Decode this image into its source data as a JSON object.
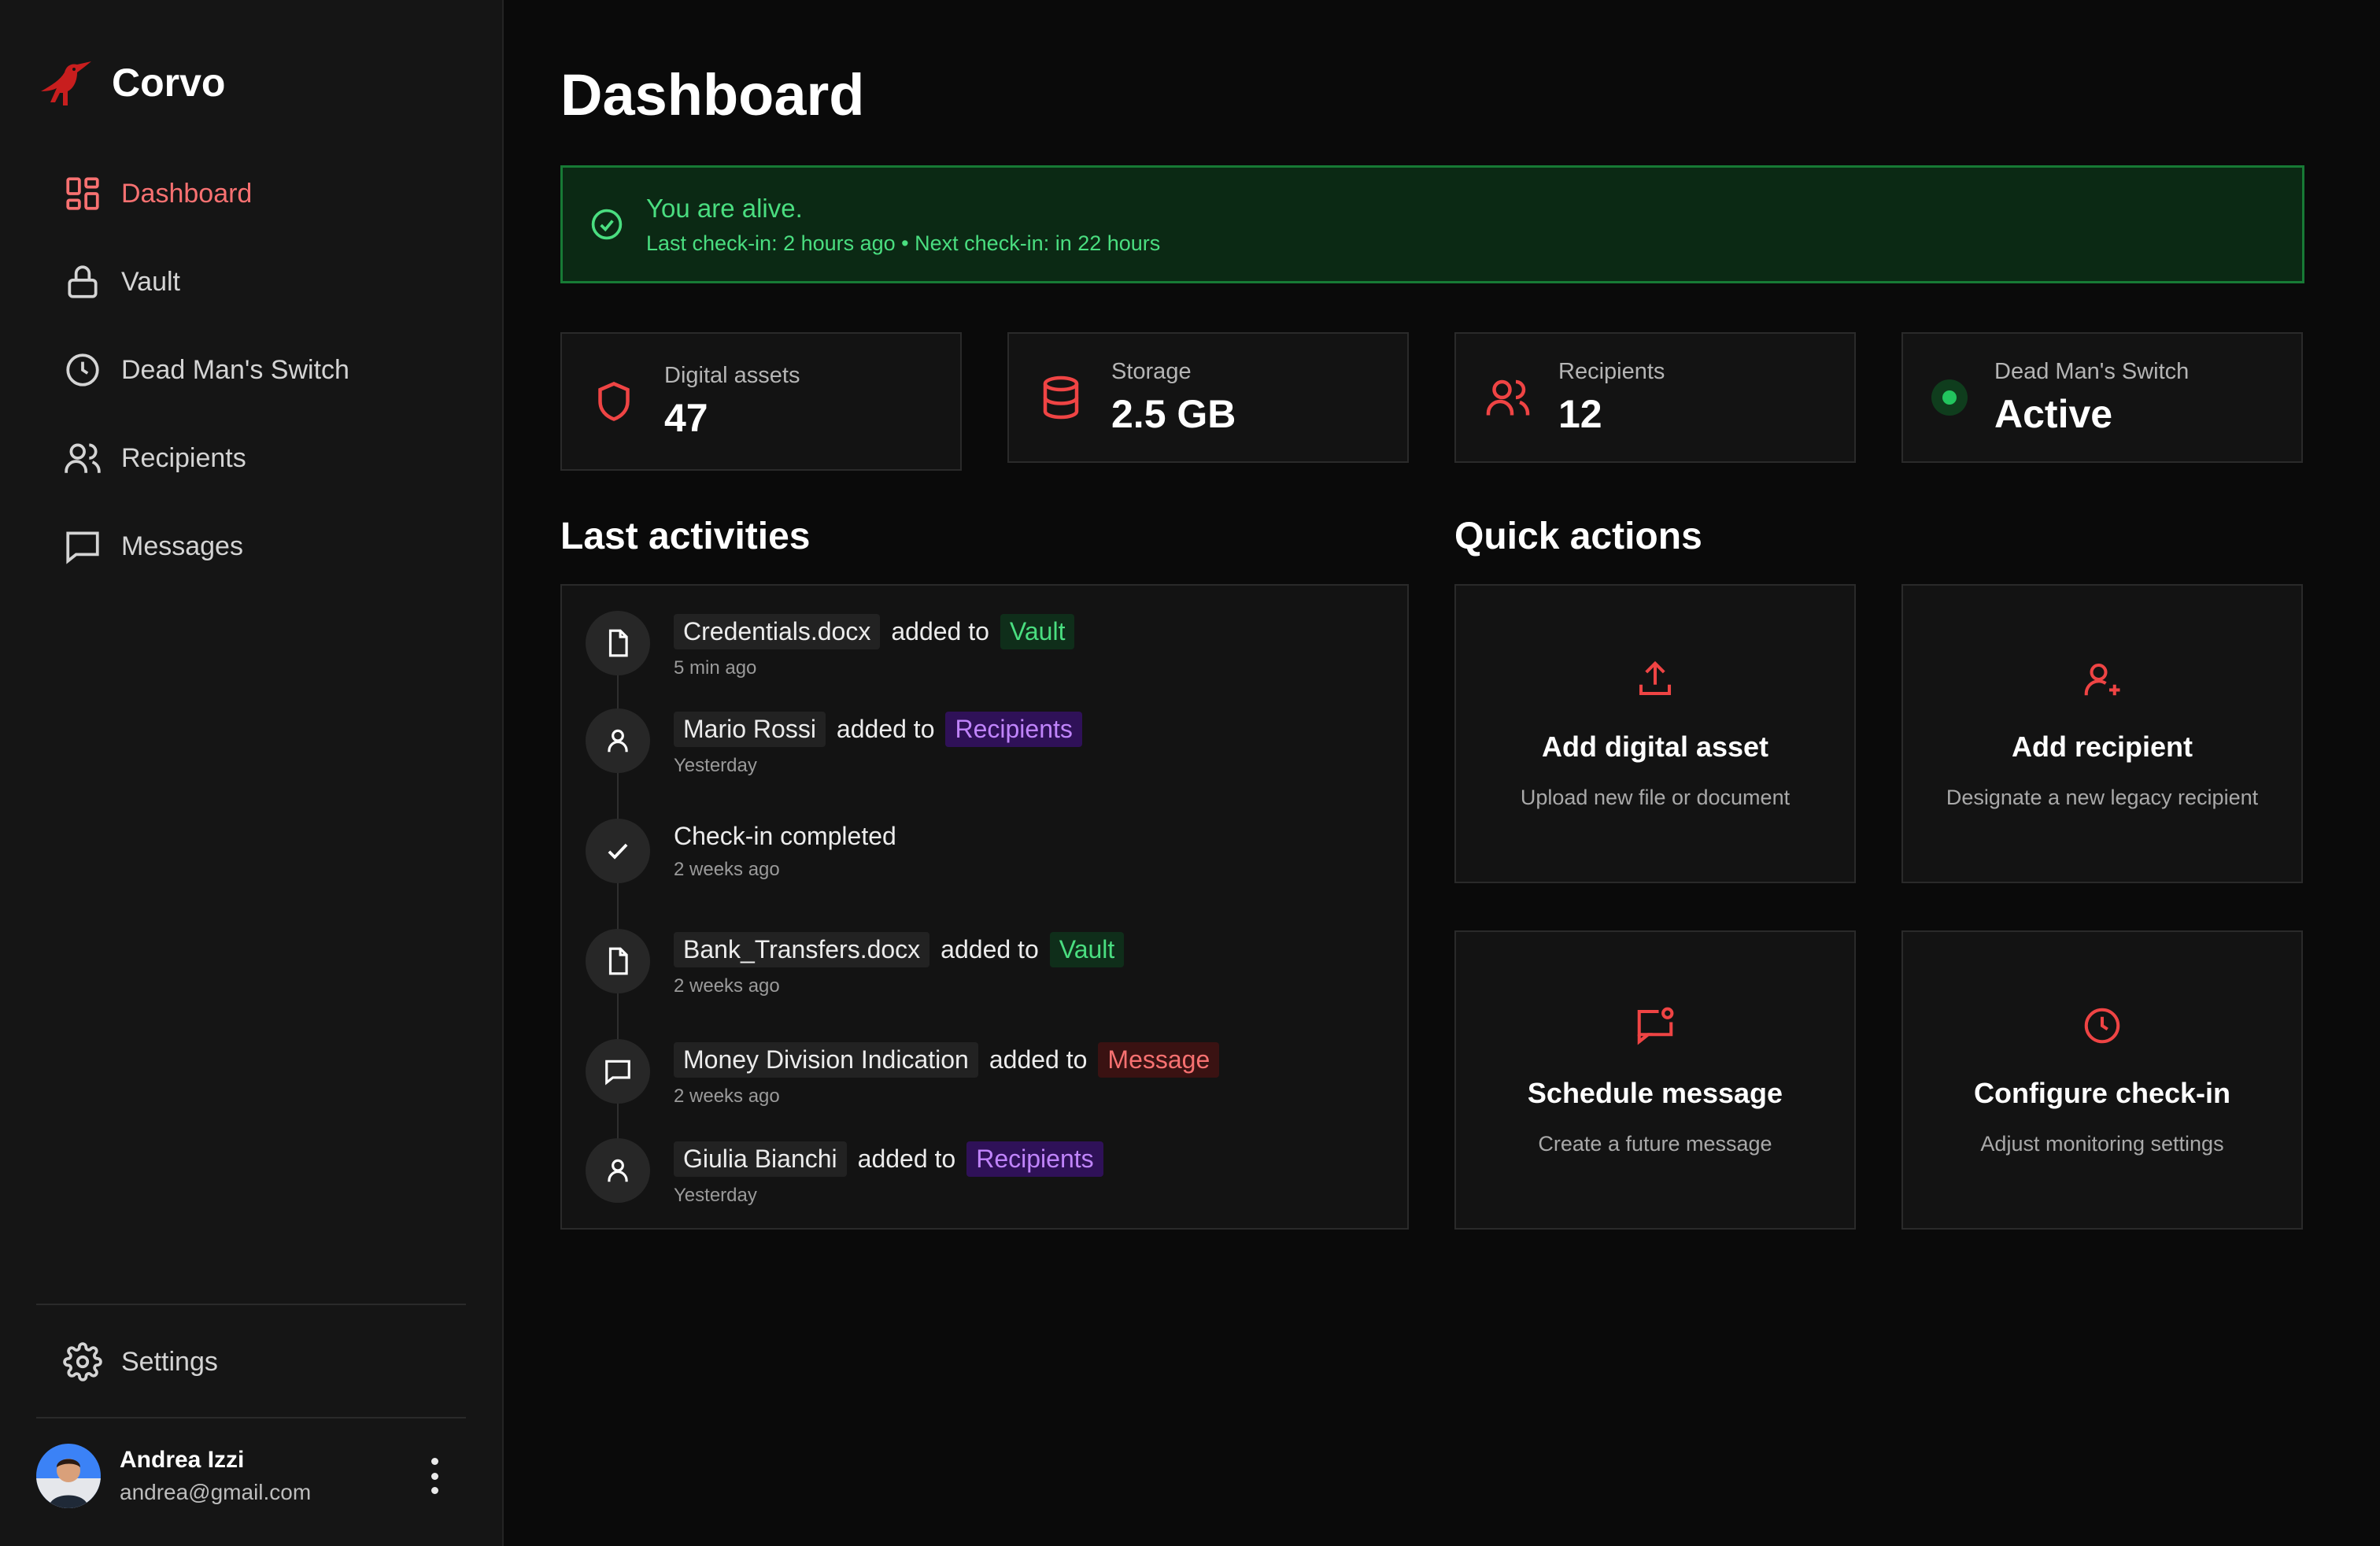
{
  "app": {
    "name": "Corvo"
  },
  "nav": [
    {
      "label": "Dashboard",
      "icon": "dashboard-grid-icon",
      "active": true
    },
    {
      "label": "Vault",
      "icon": "lock-icon"
    },
    {
      "label": "Dead Man's Switch",
      "icon": "clock-icon"
    },
    {
      "label": "Recipients",
      "icon": "users-icon"
    },
    {
      "label": "Messages",
      "icon": "message-square-icon"
    }
  ],
  "settings": {
    "label": "Settings",
    "icon": "gear-icon"
  },
  "user": {
    "name": "Andrea Izzi",
    "email": "andrea@gmail.com"
  },
  "page": {
    "title": "Dashboard"
  },
  "status": {
    "title": "You are alive.",
    "subtitle": "Last check-in: 2 hours ago • Next check-in: in 22 hours",
    "color": "#4ade80"
  },
  "stats": [
    {
      "label": "Digital assets",
      "value": "47",
      "icon": "shield-icon"
    },
    {
      "label": "Storage",
      "value": "2.5 GB",
      "icon": "database-icon"
    },
    {
      "label": "Recipients",
      "value": "12",
      "icon": "users-icon"
    },
    {
      "label": "Dead Man's Switch",
      "value": "Active",
      "icon": "status-dot"
    }
  ],
  "activities": {
    "title": "Last activities",
    "items": [
      {
        "icon": "file-icon",
        "item": "Credentials.docx",
        "verb": "added to",
        "tag": "Vault",
        "time": "5 min ago"
      },
      {
        "icon": "user-icon",
        "item": "Mario Rossi",
        "verb": "added to",
        "tag": "Recipients",
        "time": "Yesterday"
      },
      {
        "icon": "check-icon",
        "text": "Check-in completed",
        "time": "2 weeks ago"
      },
      {
        "icon": "file-icon",
        "item": "Bank_Transfers.docx",
        "verb": "added to",
        "tag": "Vault",
        "time": "2 weeks ago"
      },
      {
        "icon": "message-icon",
        "item": "Money Division Indication",
        "verb": "added to",
        "tag": "Message",
        "time": "2 weeks ago"
      },
      {
        "icon": "user-icon",
        "item": "Giulia Bianchi",
        "verb": "added to",
        "tag": "Recipients",
        "time": "Yesterday"
      }
    ]
  },
  "quick_actions": {
    "title": "Quick actions",
    "items": [
      {
        "title": "Add digital asset",
        "subtitle": "Upload new file or document",
        "icon": "upload-icon"
      },
      {
        "title": "Add recipient",
        "subtitle": "Designate a new legacy recipient",
        "icon": "user-plus-icon"
      },
      {
        "title": "Schedule message",
        "subtitle": "Create a future message",
        "icon": "message-schedule-icon"
      },
      {
        "title": "Configure check-in",
        "subtitle": "Adjust monitoring settings",
        "icon": "clock-icon"
      }
    ]
  },
  "colors": {
    "accent": "#ef4444",
    "background": "#0a0a0a",
    "sidebar": "#151515",
    "success": "#22c55e"
  }
}
